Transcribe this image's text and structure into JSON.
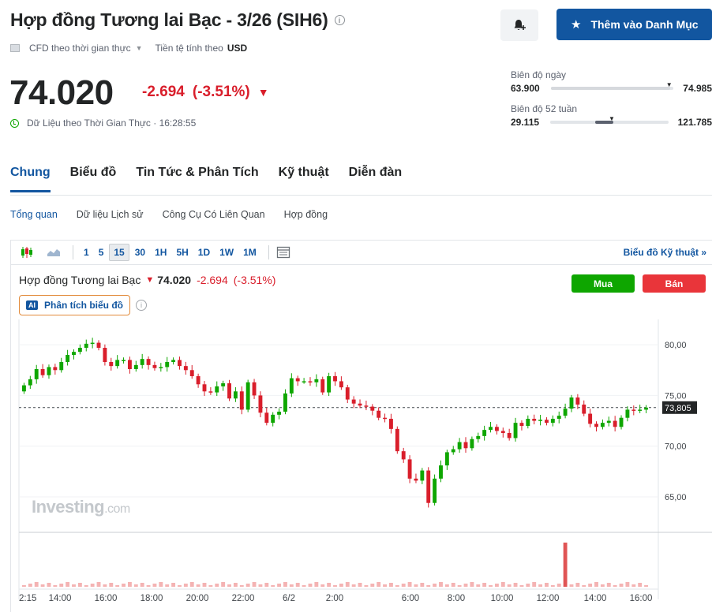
{
  "header": {
    "title": "Hợp đồng Tương lai Bạc - 3/26 (SIH6)",
    "watchlist_label": "Thêm vào Danh Mục",
    "cfd_label": "CFD theo thời gian thực",
    "currency_label": "Tiền tệ tính theo",
    "currency": "USD"
  },
  "quote": {
    "price": "74.020",
    "change": "-2.694",
    "change_pct": "(-3.51%)",
    "realtime_label": "Dữ Liệu theo Thời Gian Thực · 16:28:55"
  },
  "ranges": {
    "day_label": "Biên độ ngày",
    "day_low": "63.900",
    "day_high": "74.985",
    "week52_label": "Biên độ 52 tuần",
    "week52_low": "29.115",
    "week52_high": "121.785"
  },
  "tabs": [
    "Chung",
    "Biểu đồ",
    "Tin Tức & Phân Tích",
    "Kỹ thuật",
    "Diễn đàn"
  ],
  "subnav": [
    "Tổng quan",
    "Dữ liệu Lịch sử",
    "Công Cụ Có Liên Quan",
    "Hợp đồng"
  ],
  "toolbar": {
    "timeframes": [
      "1",
      "5",
      "15",
      "30",
      "1H",
      "5H",
      "1D",
      "1W",
      "1M"
    ],
    "active_timeframe": "15",
    "tech_chart_label": "Biểu đồ Kỹ thuật »"
  },
  "chart_panel": {
    "name": "Hợp đồng Tương lai Bạc",
    "price": "74.020",
    "change": "-2.694",
    "change_pct": "(-3.51%)",
    "buy_label": "Mua",
    "sell_label": "Bán",
    "ai_badge": "AI",
    "ai_label": "Phân tích biểu đồ",
    "watermark": "Investing",
    "watermark_suffix": ".com"
  },
  "colors": {
    "up": "#0ea600",
    "down": "#d91e2b",
    "brand": "#1256a0",
    "volume": "#f4b3b3",
    "volume_spike": "#e05555"
  },
  "chart_data": {
    "type": "candlestick",
    "ylim": [
      61.5,
      82.5
    ],
    "y_ticks": [
      "80,00",
      "75,00",
      "70,00",
      "65,00"
    ],
    "y_tick_values": [
      80,
      75,
      70,
      65
    ],
    "current_price_label": "73,805",
    "current_price": 73.805,
    "x_tick_labels": [
      "2:15",
      "14:00",
      "16:00",
      "18:00",
      "20:00",
      "22:00",
      "6/2",
      "2:00",
      "6:00",
      "8:00",
      "10:00",
      "12:00",
      "14:00",
      "16:00"
    ],
    "closes": [
      76.0,
      76.6,
      77.6,
      77.0,
      77.8,
      77.5,
      78.3,
      79.0,
      79.3,
      79.7,
      80.1,
      80.2,
      79.7,
      78.3,
      77.9,
      78.5,
      78.5,
      77.6,
      78.0,
      78.6,
      78.0,
      77.7,
      77.8,
      78.3,
      78.5,
      77.9,
      77.5,
      76.9,
      76.1,
      75.4,
      75.3,
      75.9,
      76.2,
      74.7,
      75.4,
      73.6,
      76.3,
      75.0,
      73.3,
      72.3,
      73.1,
      73.4,
      75.2,
      76.7,
      76.4,
      76.4,
      76.3,
      76.6,
      75.3,
      76.9,
      76.4,
      75.8,
      74.6,
      74.2,
      74.0,
      73.9,
      73.5,
      72.8,
      72.7,
      71.7,
      69.5,
      68.7,
      66.8,
      66.6,
      67.6,
      64.4,
      66.8,
      68.1,
      69.4,
      69.7,
      70.4,
      69.8,
      70.7,
      71.0,
      71.6,
      71.9,
      71.5,
      71.3,
      70.8,
      72.3,
      72.0,
      72.7,
      72.5,
      72.6,
      72.3,
      72.7,
      73.0,
      73.7,
      74.8,
      74.1,
      73.2,
      72.2,
      71.9,
      72.3,
      72.5,
      71.9,
      72.8,
      73.6,
      73.5,
      73.6,
      73.8
    ],
    "volume_spike_index": 87
  }
}
